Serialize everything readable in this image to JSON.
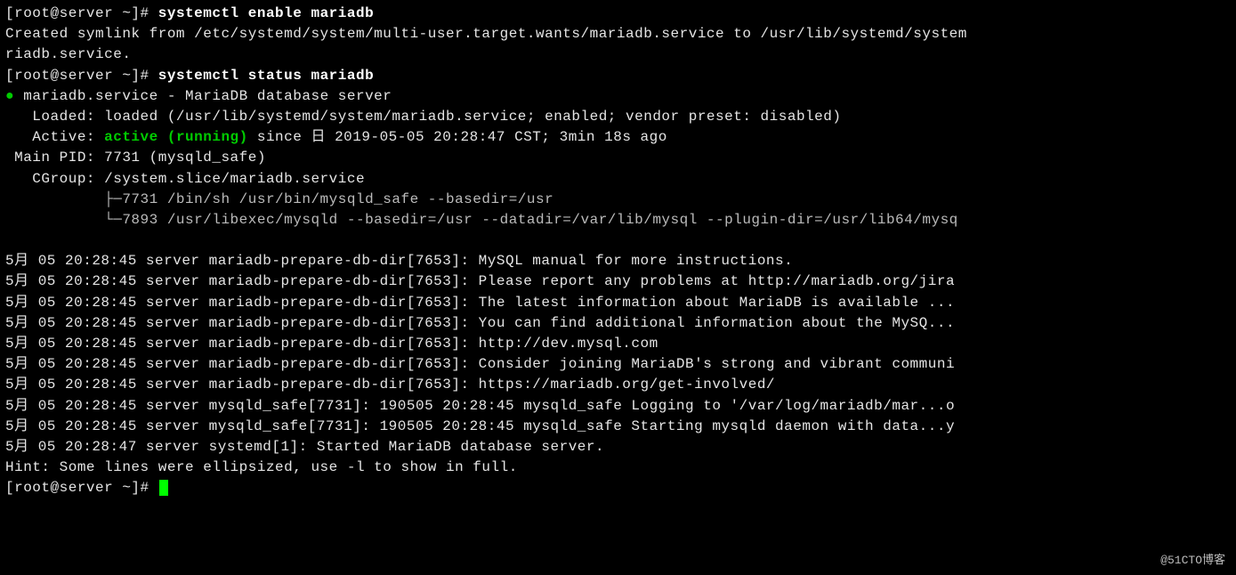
{
  "watermark": "@51CTO博客",
  "prompt1": "[root@server ~]# ",
  "cmd1": "systemctl enable mariadb",
  "symlink_line": "Created symlink from /etc/systemd/system/multi-user.target.wants/mariadb.service to /usr/lib/systemd/system",
  "symlink_line2": "riadb.service.",
  "prompt2": "[root@server ~]# ",
  "cmd2": "systemctl status mariadb",
  "bullet": "●",
  "svc_title": " mariadb.service - MariaDB database server",
  "loaded_line": "   Loaded: loaded (/usr/lib/systemd/system/mariadb.service; enabled; vendor preset: disabled)",
  "active_prefix": "   Active: ",
  "active_state": "active (running)",
  "active_rest": " since 日 2019-05-05 20:28:47 CST; 3min 18s ago",
  "main_pid": " Main PID: 7731 (mysqld_safe)",
  "cgroup_line": "   CGroup: /system.slice/mariadb.service",
  "cgroup_p1": "           ├─7731 /bin/sh /usr/bin/mysqld_safe --basedir=/usr",
  "cgroup_p2": "           └─7893 /usr/libexec/mysqld --basedir=/usr --datadir=/var/lib/mysql --plugin-dir=/usr/lib64/mysq",
  "blank": "",
  "log1": "5月 05 20:28:45 server mariadb-prepare-db-dir[7653]: MySQL manual for more instructions.",
  "log2": "5月 05 20:28:45 server mariadb-prepare-db-dir[7653]: Please report any problems at http://mariadb.org/jira",
  "log3": "5月 05 20:28:45 server mariadb-prepare-db-dir[7653]: The latest information about MariaDB is available ...",
  "log4": "5月 05 20:28:45 server mariadb-prepare-db-dir[7653]: You can find additional information about the MySQ...",
  "log5": "5月 05 20:28:45 server mariadb-prepare-db-dir[7653]: http://dev.mysql.com",
  "log6": "5月 05 20:28:45 server mariadb-prepare-db-dir[7653]: Consider joining MariaDB's strong and vibrant communi",
  "log7": "5月 05 20:28:45 server mariadb-prepare-db-dir[7653]: https://mariadb.org/get-involved/",
  "log8": "5月 05 20:28:45 server mysqld_safe[7731]: 190505 20:28:45 mysqld_safe Logging to '/var/log/mariadb/mar...o",
  "log9": "5月 05 20:28:45 server mysqld_safe[7731]: 190505 20:28:45 mysqld_safe Starting mysqld daemon with data...y",
  "log10": "5月 05 20:28:47 server systemd[1]: Started MariaDB database server.",
  "hint": "Hint: Some lines were ellipsized, use -l to show in full.",
  "prompt3": "[root@server ~]# "
}
